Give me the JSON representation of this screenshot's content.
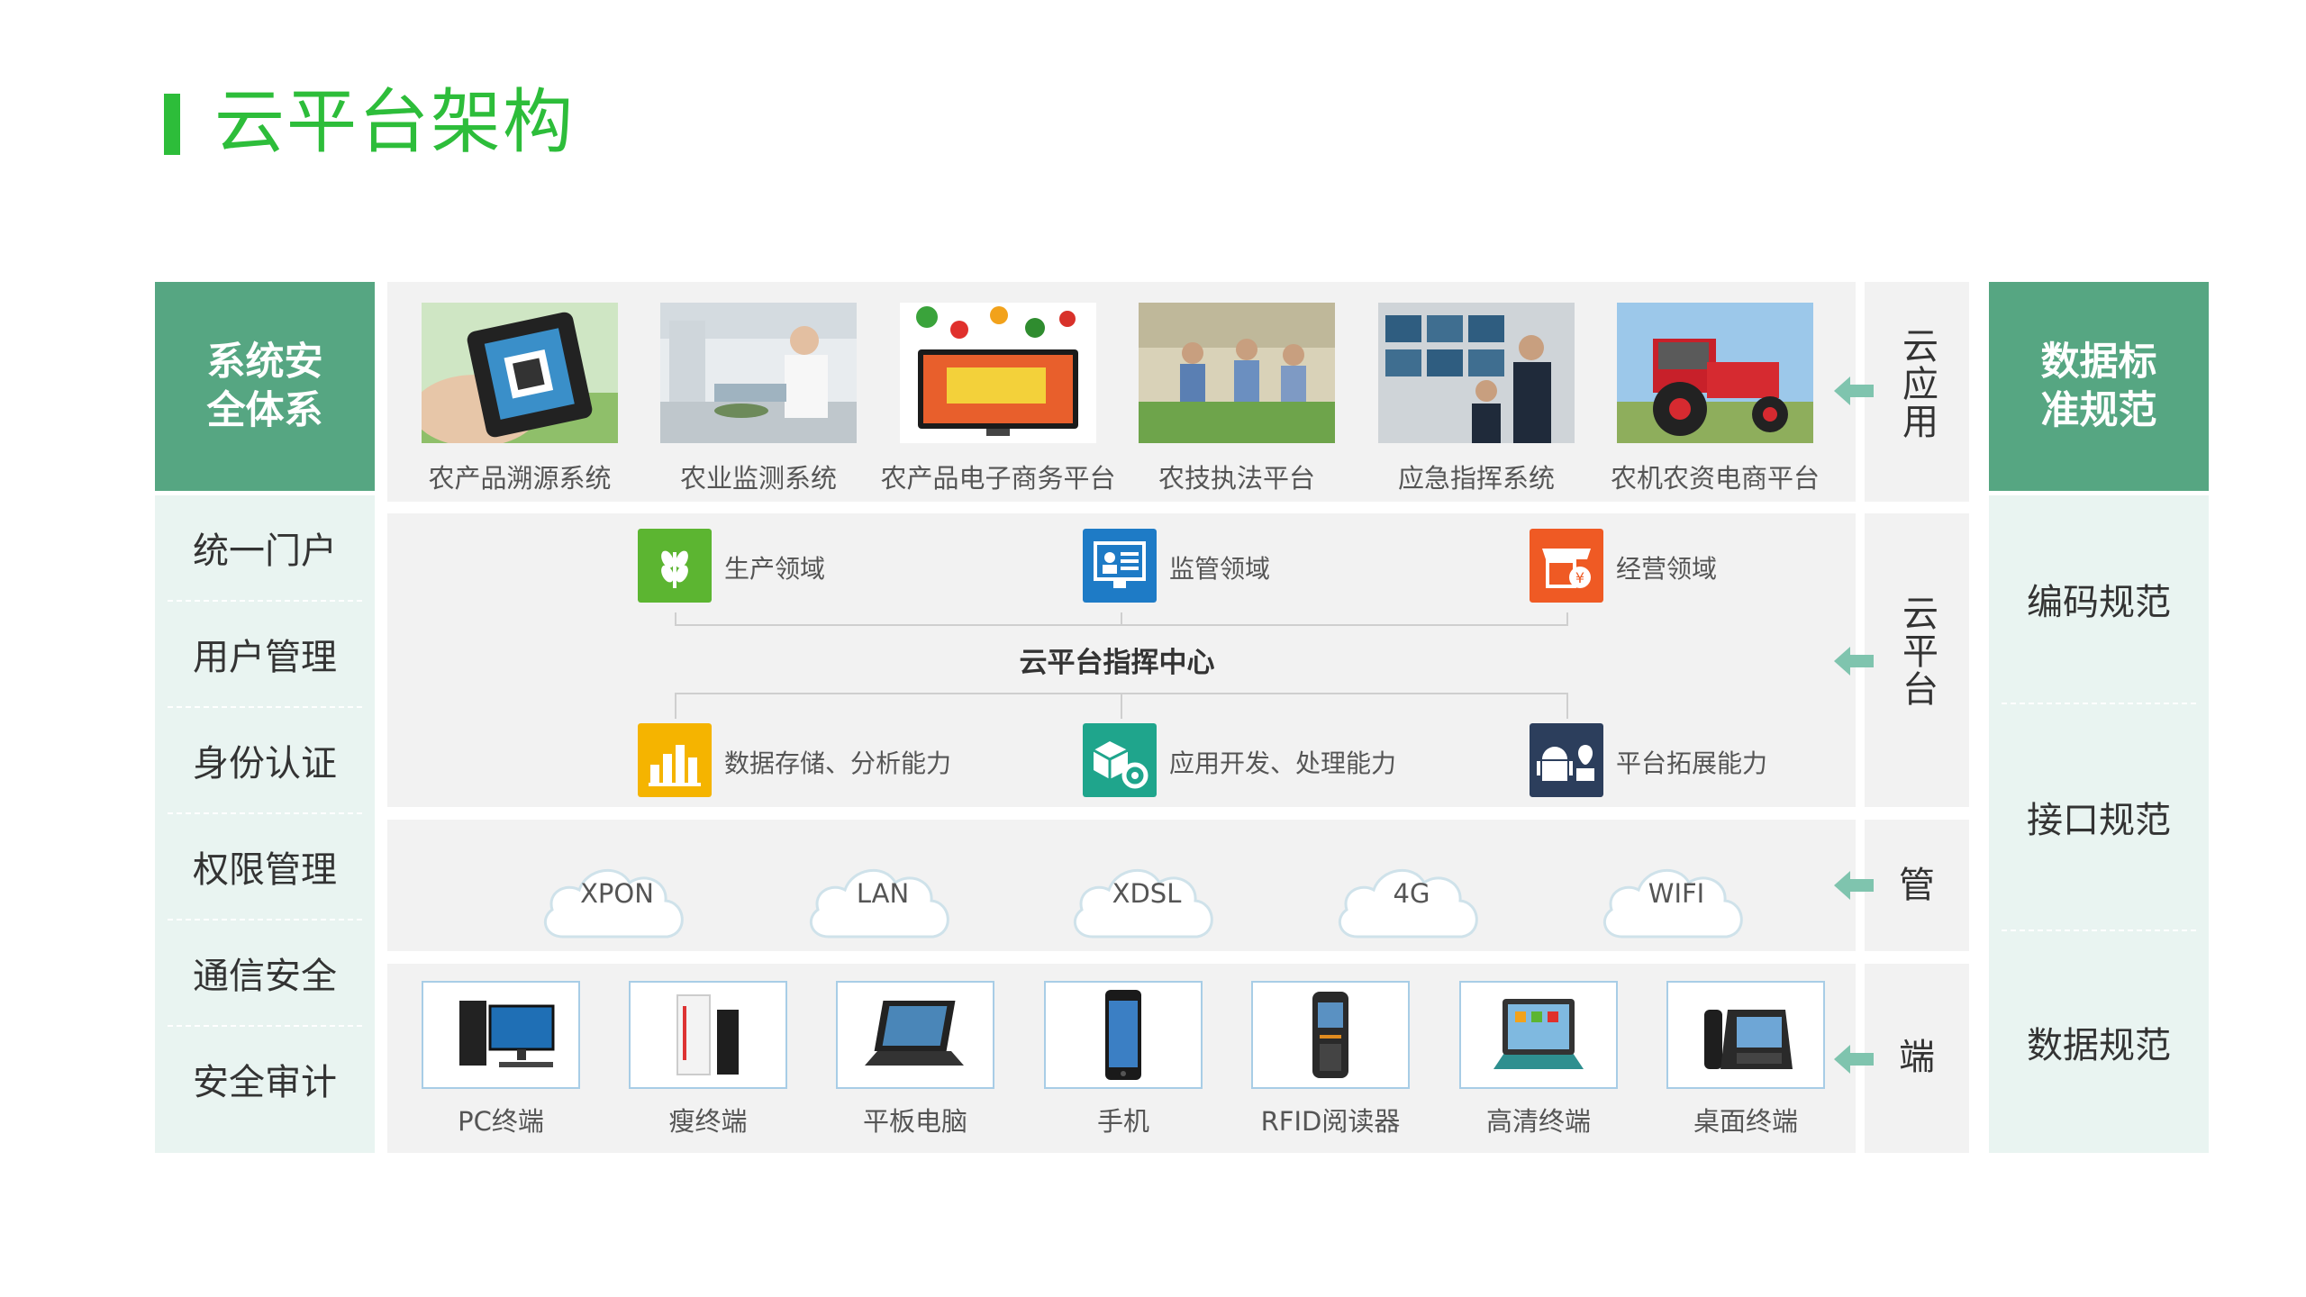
{
  "title": "云平台架构",
  "colors": {
    "accent_green": "#2dbd3a",
    "header_green": "#56a682",
    "pale_teal": "#e9f4f1",
    "panel_gray": "#f2f2f2",
    "arrow_teal": "#7fc4ae"
  },
  "security": {
    "header": [
      "系统安",
      "全体系"
    ],
    "items": [
      "统一门户",
      "用户管理",
      "身份认证",
      "权限管理",
      "通信安全",
      "安全审计"
    ]
  },
  "standards": {
    "header": [
      "数据标",
      "准规范"
    ],
    "items": [
      "编码规范",
      "接口规范",
      "数据规范"
    ]
  },
  "layers": {
    "app": "云应用",
    "platform": "云平台",
    "pipe": "管",
    "terminal": "端"
  },
  "apps": [
    {
      "label": "农产品溯源系统",
      "icon": "phone-qr-photo"
    },
    {
      "label": "农业监测系统",
      "icon": "lab-photo"
    },
    {
      "label": "农产品电子商务平台",
      "icon": "tv-vegetables-photo"
    },
    {
      "label": "农技执法平台",
      "icon": "market-inspection-photo"
    },
    {
      "label": "应急指挥系统",
      "icon": "control-room-photo"
    },
    {
      "label": "农机农资电商平台",
      "icon": "tractor-photo"
    }
  ],
  "platform": {
    "center": "云平台指挥中心",
    "top": [
      {
        "label": "生产领域",
        "icon": "wheat-icon",
        "color": "#5cb531"
      },
      {
        "label": "监管领域",
        "icon": "monitor-icon",
        "color": "#1e7bc6"
      },
      {
        "label": "经营领域",
        "icon": "shop-icon",
        "color": "#ef5a24"
      }
    ],
    "bottom": [
      {
        "label": "数据存储、分析能力",
        "icon": "bar-chart-icon",
        "color": "#f5b400"
      },
      {
        "label": "应用开发、处理能力",
        "icon": "cube-gear-icon",
        "color": "#1fa58c"
      },
      {
        "label": "平台拓展能力",
        "icon": "android-apple-icon",
        "color": "#2c3e5c"
      }
    ]
  },
  "networks": [
    "XPON",
    "LAN",
    "XDSL",
    "4G",
    "WIFI"
  ],
  "devices": [
    {
      "label": "PC终端",
      "icon": "desktop-pc-icon"
    },
    {
      "label": "瘦终端",
      "icon": "thin-client-icon"
    },
    {
      "label": "平板电脑",
      "icon": "tablet-keyboard-icon"
    },
    {
      "label": "手机",
      "icon": "smartphone-icon"
    },
    {
      "label": "RFID阅读器",
      "icon": "rfid-reader-icon"
    },
    {
      "label": "高清终端",
      "icon": "hd-terminal-icon"
    },
    {
      "label": "桌面终端",
      "icon": "desk-phone-icon"
    }
  ]
}
